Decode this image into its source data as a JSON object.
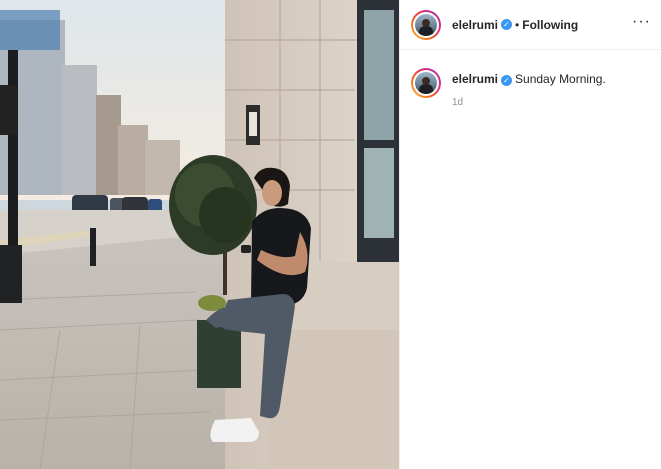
{
  "post": {
    "image_alt": "Man in black t-shirt leaning against a stone building on a London street, looking at his phone",
    "header": {
      "username": "elelrumi",
      "verified_icon": "verified-badge-icon",
      "separator": "•",
      "follow_status": "Following",
      "more_icon": "more-options-icon",
      "more_label": "···"
    },
    "caption": {
      "username": "elelrumi",
      "verified_icon": "verified-badge-icon",
      "text": "Sunday Morning.",
      "time": "1d"
    }
  },
  "colors": {
    "verified": "#3897f0",
    "text": "#262626",
    "muted": "#8e8e8e"
  }
}
